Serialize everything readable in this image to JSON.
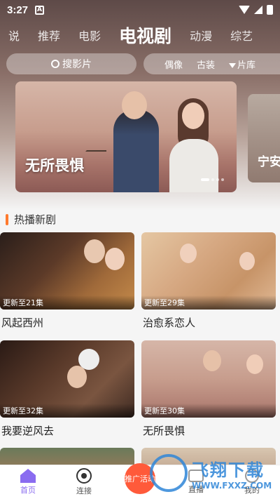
{
  "status_bar": {
    "time": "3:27",
    "notif_letter": "A"
  },
  "category_tabs": [
    "说",
    "推荐",
    "电影",
    "电视剧",
    "动漫",
    "综艺"
  ],
  "active_tab": "电视剧",
  "search": {
    "placeholder": "搜影片"
  },
  "filters": [
    "偶像",
    "古装",
    "片库"
  ],
  "banner": {
    "title": "无所畏惧",
    "next_title": "宁安"
  },
  "section": {
    "title": "热播新剧"
  },
  "dramas": [
    {
      "name": "风起西州",
      "update": "更新至21集"
    },
    {
      "name": "治愈系恋人",
      "update": "更新至29集"
    },
    {
      "name": "我要逆风去",
      "update": "更新至32集"
    },
    {
      "name": "无所畏惧",
      "update": "更新至30集"
    }
  ],
  "bottom_nav": {
    "home": "首页",
    "connect": "连接",
    "promo": "推广活动",
    "live": "直播",
    "me": "我的"
  },
  "watermark": {
    "big": "飞翔下载",
    "small": "WWW.FXXZ.COM"
  }
}
